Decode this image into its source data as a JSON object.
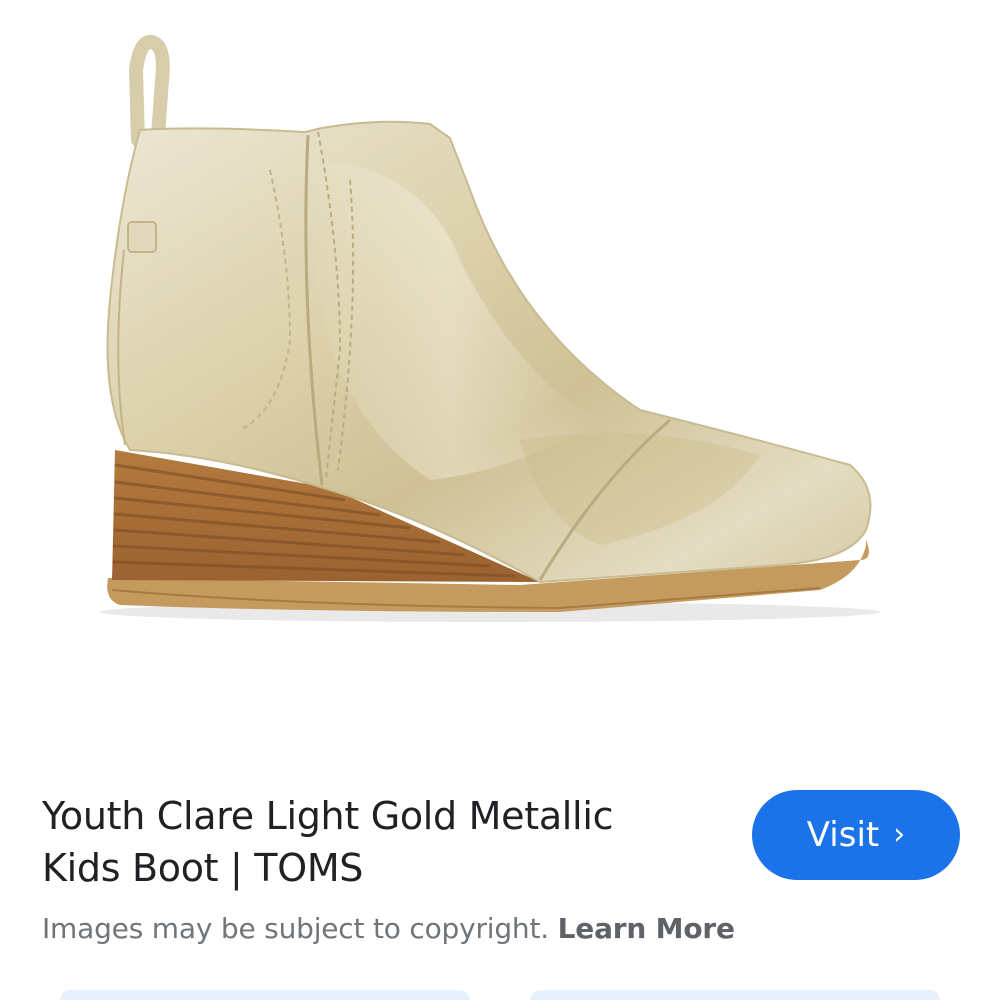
{
  "product": {
    "title_line1": "Youth Clare Light Gold Metallic",
    "title_line2": "Kids Boot | TOMS"
  },
  "actions": {
    "visit_label": "Visit",
    "visit_icon": "chevron-right-icon"
  },
  "notice": {
    "copyright_text": "Images may be subject to copyright.",
    "learn_more_label": "Learn More"
  },
  "colors": {
    "accent": "#1a73e8",
    "title_text": "#202124",
    "secondary_text": "#70757a"
  }
}
